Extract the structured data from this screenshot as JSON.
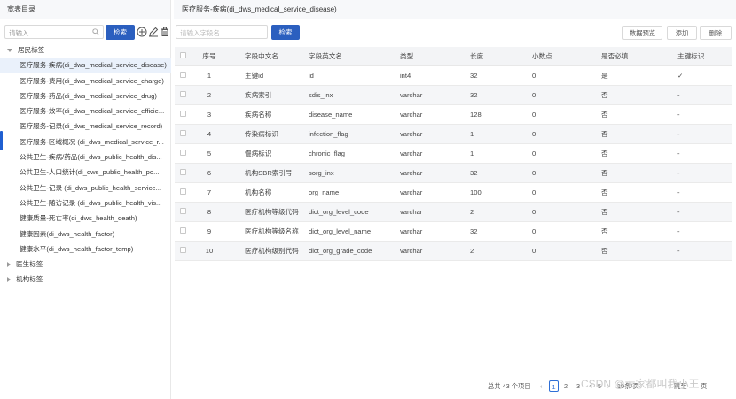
{
  "left": {
    "title": "宽表目录",
    "search_placeholder": "请输入",
    "search_button": "检索",
    "tree": [
      {
        "type": "group",
        "label": "居民标签",
        "expanded": true
      },
      {
        "type": "child",
        "label": "医疗服务-疾病(di_dws_medical_service_disease)",
        "selected": true
      },
      {
        "type": "child",
        "label": "医疗服务-费用(di_dws_medical_service_charge)"
      },
      {
        "type": "child",
        "label": "医疗服务-药品(di_dws_medical_service_drug)"
      },
      {
        "type": "child",
        "label": "医疗服务-效率(di_dws_medical_service_efficie..."
      },
      {
        "type": "child",
        "label": "医疗服务-记录(di_dws_medical_service_record)"
      },
      {
        "type": "child",
        "label": "医疗服务-区域概况 (di_dws_medical_service_r..."
      },
      {
        "type": "child",
        "label": "公共卫生-疾病/药品(di_dws_public_health_dis..."
      },
      {
        "type": "child",
        "label": "公共卫生-人口统计(di_dws_public_health_po..."
      },
      {
        "type": "child",
        "label": "公共卫生-记录 (di_dws_public_health_service..."
      },
      {
        "type": "child",
        "label": "公共卫生-随访记录 (di_dws_public_health_vis..."
      },
      {
        "type": "child",
        "label": "健康质量-死亡率(di_dws_health_death)"
      },
      {
        "type": "child",
        "label": "健康因素(di_dws_health_factor)"
      },
      {
        "type": "child",
        "label": "健康水平(di_dws_health_factor_temp)"
      },
      {
        "type": "group",
        "label": "医生标签",
        "expanded": false
      },
      {
        "type": "group",
        "label": "机构标签",
        "expanded": false
      }
    ]
  },
  "right": {
    "title": "医疗服务-疾病(di_dws_medical_service_disease)",
    "search_placeholder": "请输入字段名",
    "search_button": "检索",
    "buttons": {
      "preview": "数据预览",
      "add": "添加",
      "delete": "删除"
    },
    "columns": [
      "序号",
      "字段中文名",
      "字段英文名",
      "类型",
      "长度",
      "小数点",
      "是否必填",
      "主键标识"
    ],
    "rows": [
      {
        "no": "1",
        "cn": "主键id",
        "en": "id",
        "type": "int4",
        "len": "32",
        "dec": "0",
        "req": "是",
        "pk": "✓"
      },
      {
        "no": "2",
        "cn": "疾病索引",
        "en": "sdis_inx",
        "type": "varchar",
        "len": "32",
        "dec": "0",
        "req": "否",
        "pk": "-"
      },
      {
        "no": "3",
        "cn": "疾病名称",
        "en": "disease_name",
        "type": "varchar",
        "len": "128",
        "dec": "0",
        "req": "否",
        "pk": "-"
      },
      {
        "no": "4",
        "cn": "传染病标识",
        "en": "infection_flag",
        "type": "varchar",
        "len": "1",
        "dec": "0",
        "req": "否",
        "pk": "-"
      },
      {
        "no": "5",
        "cn": "慢病标识",
        "en": "chronic_flag",
        "type": "varchar",
        "len": "1",
        "dec": "0",
        "req": "否",
        "pk": "-"
      },
      {
        "no": "6",
        "cn": "机构SBR索引号",
        "en": "sorg_inx",
        "type": "varchar",
        "len": "32",
        "dec": "0",
        "req": "否",
        "pk": "-"
      },
      {
        "no": "7",
        "cn": "机构名称",
        "en": "org_name",
        "type": "varchar",
        "len": "100",
        "dec": "0",
        "req": "否",
        "pk": "-"
      },
      {
        "no": "8",
        "cn": "医疗机构等级代码",
        "en": "dict_org_level_code",
        "type": "varchar",
        "len": "2",
        "dec": "0",
        "req": "否",
        "pk": "-"
      },
      {
        "no": "9",
        "cn": "医疗机构等级名称",
        "en": "dict_org_level_name",
        "type": "varchar",
        "len": "32",
        "dec": "0",
        "req": "否",
        "pk": "-"
      },
      {
        "no": "10",
        "cn": "医疗机构级别代码",
        "en": "dict_org_grade_code",
        "type": "varchar",
        "len": "2",
        "dec": "0",
        "req": "否",
        "pk": "-"
      }
    ],
    "pager": {
      "total": "总共 43 个项目",
      "pages": [
        "1",
        "2",
        "3"
      ],
      "current": "1",
      "size_text": "10条/页",
      "goto": "跳至",
      "page_unit": "页"
    }
  },
  "watermark": "CSDN @大家都叫我小王",
  "colors": {
    "primary": "#2b5fbf",
    "link": "#2f6fd6"
  }
}
